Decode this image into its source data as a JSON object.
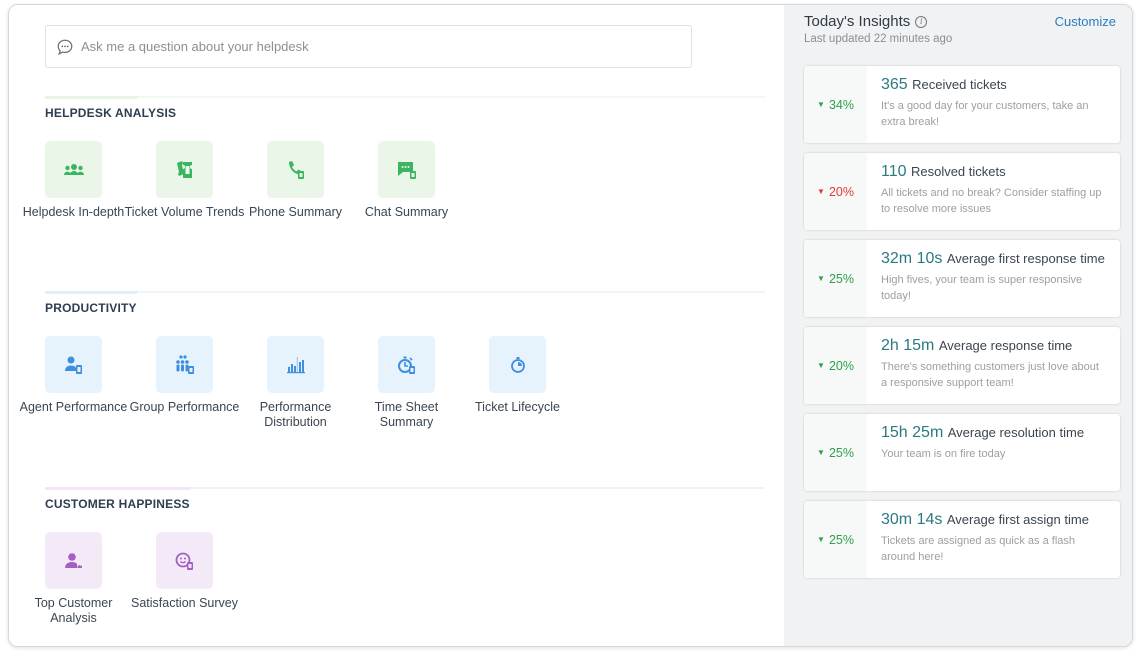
{
  "search": {
    "placeholder": "Ask me a question about your helpdesk",
    "icon": "chat-bubble-icon"
  },
  "sections": [
    {
      "title": "HELPDESK ANALYSIS",
      "color": "#3cb563",
      "items": [
        {
          "label": "Helpdesk In-depth",
          "icon": "people-group-icon"
        },
        {
          "label": "Ticket Volume Trends",
          "icon": "tickets-icon"
        },
        {
          "label": "Phone Summary",
          "icon": "phone-report-icon"
        },
        {
          "label": "Chat Summary",
          "icon": "chat-report-icon"
        }
      ]
    },
    {
      "title": "PRODUCTIVITY",
      "color": "#3e8fe0",
      "items": [
        {
          "label": "Agent Performance",
          "icon": "agent-report-icon"
        },
        {
          "label": "Group Performance",
          "icon": "group-report-icon"
        },
        {
          "label": "Performance Distribution",
          "icon": "bar-distribution-icon"
        },
        {
          "label": "Time Sheet Summary",
          "icon": "stopwatch-report-icon"
        },
        {
          "label": "Ticket Lifecycle",
          "icon": "timer-icon"
        }
      ]
    },
    {
      "title": "CUSTOMER HAPPINESS",
      "color": "#a35fc4",
      "items": [
        {
          "label": "Top Customer Analysis",
          "icon": "customer-crown-icon"
        },
        {
          "label": "Satisfaction Survey",
          "icon": "smiley-report-icon"
        }
      ]
    }
  ],
  "insights": {
    "title": "Today's Insights",
    "subtitle": "Last updated 22 minutes ago",
    "customize_label": "Customize",
    "cards": [
      {
        "change": "34%",
        "trend": "down",
        "sentiment": "good",
        "value": "365",
        "metric": "Received tickets",
        "description": "It's a good day for your customers, take an extra break!"
      },
      {
        "change": "20%",
        "trend": "down",
        "sentiment": "bad",
        "value": "110",
        "metric": "Resolved tickets",
        "description": "All tickets and no break? Consider staffing up to resolve more issues"
      },
      {
        "change": "25%",
        "trend": "down",
        "sentiment": "good",
        "value": "32m 10s",
        "metric": "Average first response time",
        "description": "High fives, your team is super responsive today!"
      },
      {
        "change": "20%",
        "trend": "down",
        "sentiment": "good",
        "value": "2h 15m",
        "metric": "Average response time",
        "description": "There's something customers just love about a responsive support team!"
      },
      {
        "change": "25%",
        "trend": "down",
        "sentiment": "good",
        "value": "15h 25m",
        "metric": "Average resolution time",
        "description": "Your team is on fire today"
      },
      {
        "change": "25%",
        "trend": "down",
        "sentiment": "good",
        "value": "30m 14s",
        "metric": "Average first assign time",
        "description": "Tickets are assigned as quick as a flash around here!"
      }
    ],
    "colors": {
      "good": "#2da14a",
      "bad": "#e53935",
      "value": "#2b7a80",
      "link": "#2d7bbf"
    }
  }
}
